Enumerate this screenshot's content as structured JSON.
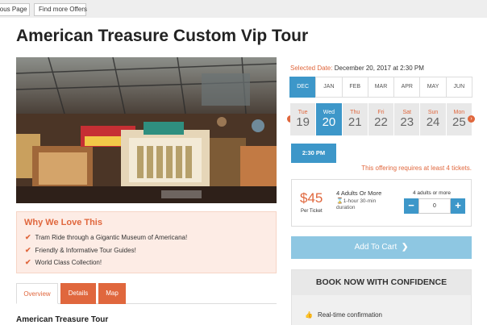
{
  "topbar": {
    "prev_label": "ious Page",
    "offers_label": "Find more Offers"
  },
  "page_title": "American Treasure Custom Vip Tour",
  "why": {
    "heading": "Why We Love This",
    "items": [
      "Tram Ride through a Gigantic Museum of Americana!",
      "Friendly & Informative Tour Guides!",
      "World Class Collection!"
    ]
  },
  "tabs": [
    "Overview",
    "Details",
    "Map"
  ],
  "section_title": "American Treasure Tour",
  "selected": {
    "label": "Selected Date:",
    "value": "December 20, 2017 at 2:30 PM"
  },
  "months": [
    "DEC",
    "JAN",
    "FEB",
    "MAR",
    "APR",
    "MAY",
    "JUN"
  ],
  "days": [
    {
      "name": "Tue",
      "num": "19"
    },
    {
      "name": "Wed",
      "num": "20"
    },
    {
      "name": "Thu",
      "num": "21"
    },
    {
      "name": "Fri",
      "num": "22"
    },
    {
      "name": "Sat",
      "num": "23"
    },
    {
      "name": "Sun",
      "num": "24"
    },
    {
      "name": "Mon",
      "num": "25"
    }
  ],
  "time_label": "2:30 PM",
  "notice": "This offering requires at least 4 tickets.",
  "ticket": {
    "price": "$45",
    "per": "Per Ticket",
    "name": "4 Adults Or More",
    "duration_line1": "1-hour 30-min",
    "duration_line2": "duration",
    "qty_label": "4 adults or more",
    "qty_value": "0",
    "minus": "−",
    "plus": "+"
  },
  "cart_label": "Add To Cart",
  "confidence": {
    "heading": "BOOK NOW WITH CONFIDENCE",
    "item": "Real-time confirmation"
  },
  "colors": {
    "accent": "#e0673d",
    "blue": "#3d97c9",
    "cart": "#8ec7e2"
  }
}
